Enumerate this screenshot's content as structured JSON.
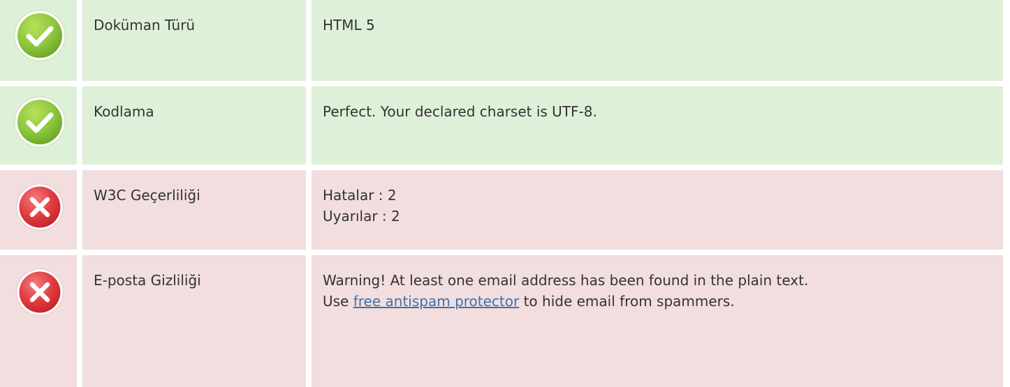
{
  "rows": [
    {
      "status": "pass",
      "icon": "check-circle-icon",
      "label": "Doküman Türü",
      "value": "HTML 5"
    },
    {
      "status": "pass",
      "icon": "check-circle-icon",
      "label": "Kodlama",
      "value": "Perfect. Your declared charset is UTF-8."
    },
    {
      "status": "fail",
      "icon": "error-x-icon",
      "label": "W3C Geçerliliği",
      "errors": "Hatalar : 2",
      "warnings": "Uyarılar : 2"
    },
    {
      "status": "fail",
      "icon": "error-x-icon",
      "label": "E-posta Gizliliği",
      "warning_line": "Warning! At least one email address has been found in the plain text.",
      "use_prefix": "Use ",
      "link_text": "free antispam protector",
      "use_suffix": " to hide email from spammers."
    }
  ],
  "colors": {
    "pass_bg": "#dff0d8",
    "fail_bg": "#f2dede",
    "pass_icon": "#8cc63f",
    "fail_icon": "#e0393e",
    "link": "#3b73ae"
  }
}
